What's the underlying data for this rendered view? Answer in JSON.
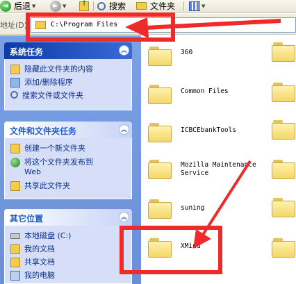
{
  "toolbar": {
    "back_label": "后退",
    "search_label": "搜索",
    "folders_label": "文件夹"
  },
  "address": {
    "label": "地址(D)",
    "path": "C:\\Program Files"
  },
  "taskpane": {
    "system_tasks": {
      "title": "系统任务",
      "items": [
        "隐藏此文件夹的内容",
        "添加/删除程序",
        "搜索文件或文件夹"
      ]
    },
    "file_tasks": {
      "title": "文件和文件夹任务",
      "items": [
        "创建一个新文件夹",
        "将这个文件夹发布到\nWeb",
        "共享此文件夹"
      ]
    },
    "other_places": {
      "title": "其它位置",
      "items": [
        "本地磁盘 (C:)",
        "我的文档",
        "共享文档",
        "我的电脑"
      ]
    }
  },
  "folders": [
    {
      "name": "360"
    },
    {
      "name": "Common Files"
    },
    {
      "name": "ICBCEbankTools"
    },
    {
      "name": "Mozilla Maintenance\nService"
    },
    {
      "name": "suning"
    },
    {
      "name": "XMind"
    }
  ],
  "colors": {
    "annotation": "#ef2a2a",
    "taskpane": "#7aa1e6",
    "link": "#0c2f8c"
  }
}
